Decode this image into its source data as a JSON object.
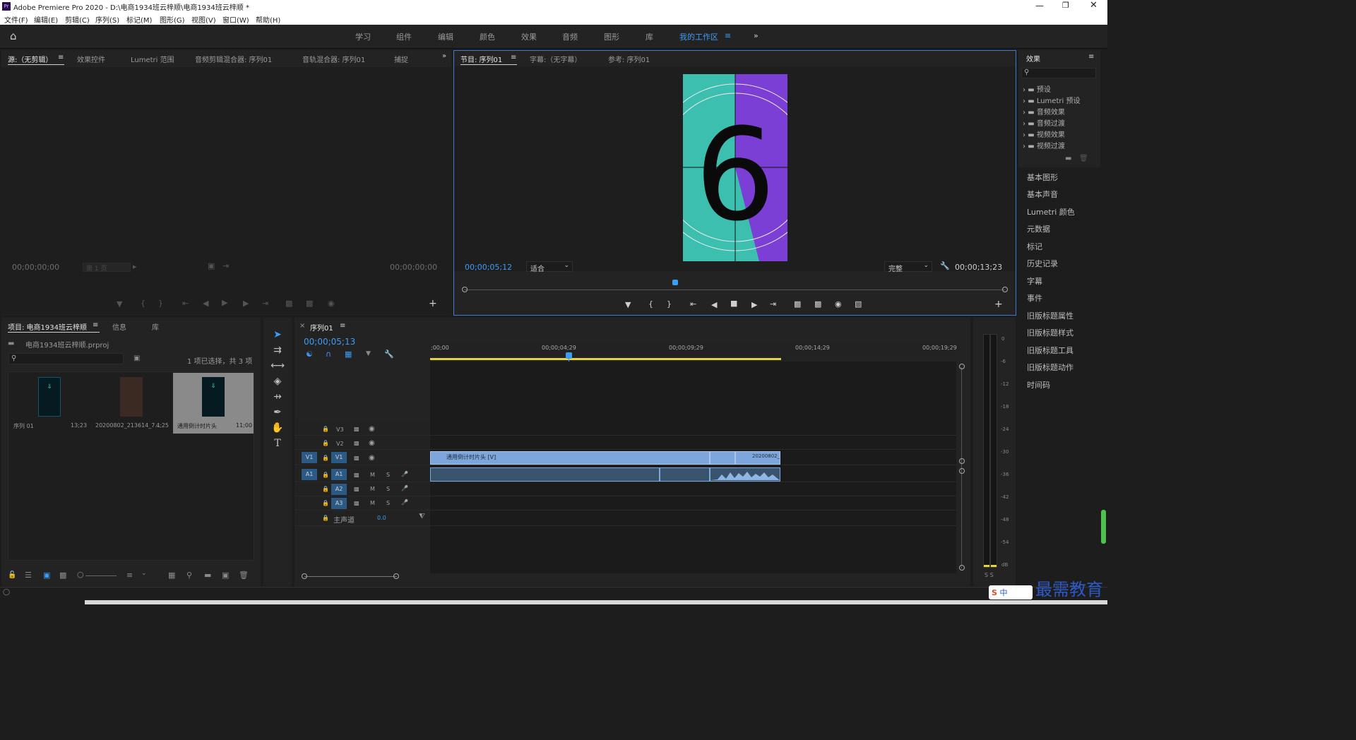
{
  "titlebar": {
    "app_icon": "Pr",
    "title": "Adobe Premiere Pro 2020 - D:\\电商1934班云梓顺\\电商1934班云梓顺 *"
  },
  "menu": [
    "文件(F)",
    "编辑(E)",
    "剪辑(C)",
    "序列(S)",
    "标记(M)",
    "图形(G)",
    "视图(V)",
    "窗口(W)",
    "帮助(H)"
  ],
  "workspaces": [
    "学习",
    "组件",
    "编辑",
    "颜色",
    "效果",
    "音频",
    "图形",
    "库",
    "我的工作区"
  ],
  "source_panel": {
    "tabs": [
      "源:（无剪辑）",
      "效果控件",
      "Lumetri 范围",
      "音频剪辑混合器: 序列01",
      "音轨混合器: 序列01",
      "捕捉"
    ],
    "tc_left": "00;00;00;00",
    "page": "第 1 页",
    "tc_right": "00;00;00;00"
  },
  "program_panel": {
    "tabs": [
      "节目: 序列01",
      "字幕:（无字幕）",
      "参考: 序列01"
    ],
    "tc_left": "00;00;05;12",
    "fit": "适合",
    "quality": "完整",
    "tc_right": "00;00;13;23",
    "countdown_digit": "6"
  },
  "effects_panel": {
    "title": "效果",
    "items": [
      "预设",
      "Lumetri 预设",
      "音频效果",
      "音频过渡",
      "视频效果",
      "视频过渡"
    ]
  },
  "right_panels": [
    "基本图形",
    "基本声音",
    "Lumetri 颜色",
    "元数据",
    "标记",
    "历史记录",
    "字幕",
    "事件",
    "旧版标题属性",
    "旧版标题样式",
    "旧版标题工具",
    "旧版标题动作",
    "时间码"
  ],
  "project_panel": {
    "tabs": [
      "项目: 电商1934班云梓顺",
      "信息",
      "库"
    ],
    "filename": "电商1934班云梓顺.prproj",
    "selection": "1 项已选择，共 3 项",
    "items": [
      {
        "name": "序列 01",
        "dur": "13;23"
      },
      {
        "name": "20200802_213614_7...",
        "dur": "4;25"
      },
      {
        "name": "通用倒计时片头",
        "dur": "11;00"
      }
    ]
  },
  "timeline": {
    "tab": "序列01",
    "tc": "00;00;05;13",
    "ruler": [
      ";00;00",
      "00;00;04;29",
      "00;00;09;29",
      "00;00;14;29",
      "00;00;19;29"
    ],
    "tracks": [
      "V3",
      "V2",
      "V1",
      "A1",
      "A2",
      "A3"
    ],
    "master": "主声道",
    "master_val": "0.0",
    "clip_v1_a": "通用倒计时片头 [V]",
    "clip_v1_b": "20200802_"
  },
  "meter_scale": [
    "0",
    "-6",
    "-12",
    "-18",
    "-24",
    "-30",
    "-36",
    "-42",
    "-48",
    "-54",
    "dB"
  ],
  "meter_solo": "S S",
  "watermark": "最需教育",
  "ime": "中"
}
